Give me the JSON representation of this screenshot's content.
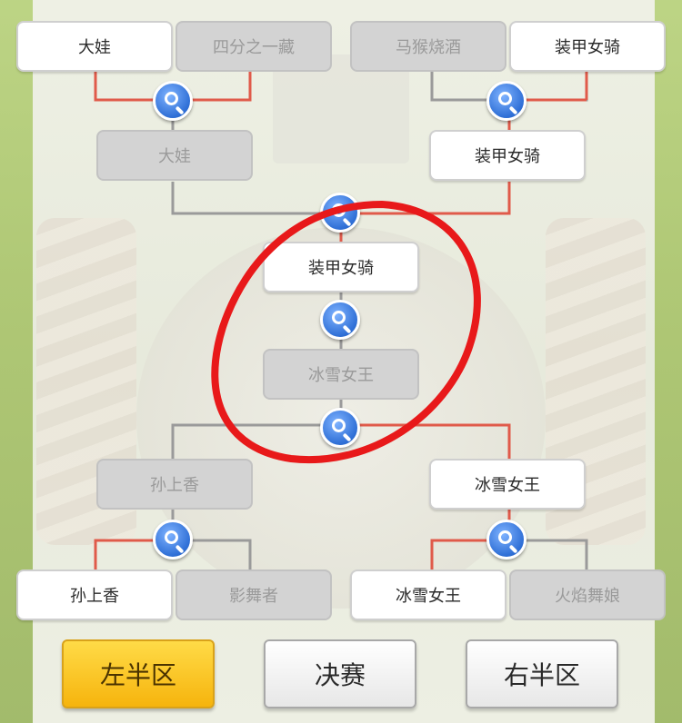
{
  "bracket": {
    "round_of_8": [
      {
        "name": "大娃",
        "status": "win"
      },
      {
        "name": "四分之一藏",
        "status": "lose"
      },
      {
        "name": "马猴烧酒",
        "status": "lose"
      },
      {
        "name": "装甲女骑",
        "status": "win"
      },
      {
        "name": "孙上香",
        "status": "win"
      },
      {
        "name": "影舞者",
        "status": "lose"
      },
      {
        "name": "冰雪女王",
        "status": "win"
      },
      {
        "name": "火焰舞娘",
        "status": "lose"
      }
    ],
    "semifinal": [
      {
        "name": "大娃",
        "status": "lose"
      },
      {
        "name": "装甲女骑",
        "status": "win"
      },
      {
        "name": "孙上香",
        "status": "lose"
      },
      {
        "name": "冰雪女王",
        "status": "win"
      }
    ],
    "final": [
      {
        "name": "装甲女骑",
        "status": "win"
      },
      {
        "name": "冰雪女王",
        "status": "lose"
      }
    ]
  },
  "tabs": {
    "left_half": "左半区",
    "final": "决赛",
    "right_half": "右半区",
    "active": "left_half"
  },
  "icons": {
    "view_match": "magnifier-icon"
  },
  "colors": {
    "win_line": "#e05a4a",
    "neutral_line": "#9a9a9a",
    "active_tab": "#f6b40d",
    "annotation": "#e8191a"
  }
}
